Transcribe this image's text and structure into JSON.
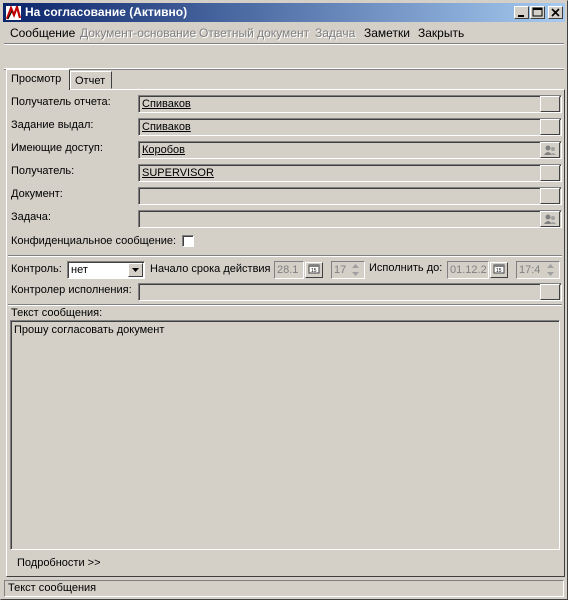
{
  "window": {
    "title": "На согласование (Активно)",
    "icon": "app-logo-icon"
  },
  "menu": {
    "items": [
      {
        "label": "Сообщение",
        "enabled": true
      },
      {
        "label": "Документ-основание",
        "enabled": false
      },
      {
        "label": "Ответный документ",
        "enabled": false
      },
      {
        "label": "Задача",
        "enabled": false
      },
      {
        "label": "Заметки",
        "enabled": true
      },
      {
        "label": "Закрыть",
        "enabled": true
      }
    ]
  },
  "tabs": [
    {
      "label": "Просмотр",
      "active": true
    },
    {
      "label": "Отчет",
      "active": false
    }
  ],
  "form": {
    "report_recipient_label": "Получатель отчета:",
    "report_recipient_value": "Спиваков",
    "task_issued_label": "Задание выдал:",
    "task_issued_value": "Спиваков",
    "access_label": "Имеющие доступ:",
    "access_value": "Коробов",
    "recipient_label": "Получатель:",
    "recipient_value": "SUPERVISOR",
    "document_label": "Документ:",
    "document_value": "",
    "task_label": "Задача:",
    "task_value": "",
    "confidential_label": "Конфиденциальное сообщение:",
    "confidential_checked": false
  },
  "control": {
    "control_label": "Контроль:",
    "control_value": "нет",
    "start_label": "Начало срока действия",
    "start_date": "28.1",
    "start_hour": "17",
    "due_label": "Исполнить до:",
    "due_date": "01.12.2",
    "due_hour": "17:4",
    "controller_label": "Контролер исполнения:",
    "controller_value": ""
  },
  "message": {
    "label": "Текст сообщения:",
    "text": "Прошу согласовать  документ"
  },
  "details_label": "Подробности >>",
  "status": {
    "text": "Текст сообщения"
  }
}
